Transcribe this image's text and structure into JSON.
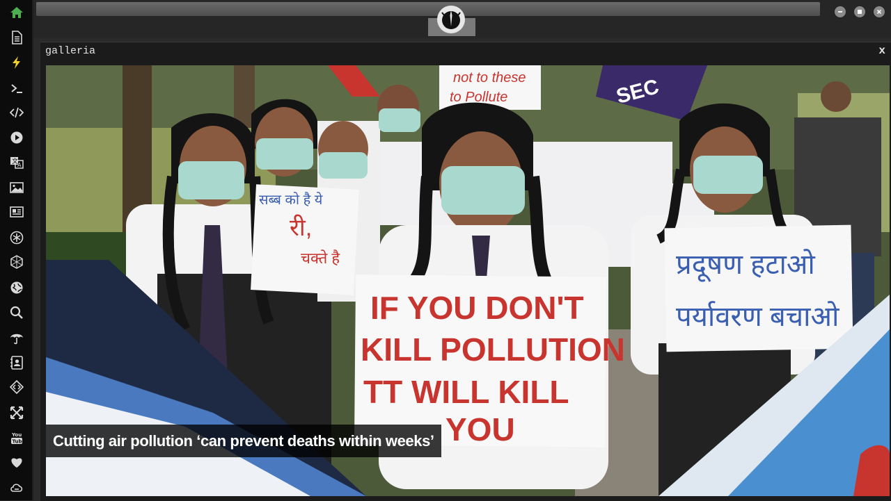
{
  "window": {
    "panel_title": "galleria",
    "close_label": "x"
  },
  "sidebar": {
    "items": [
      {
        "icon": "home-icon",
        "color": "#4caf50"
      },
      {
        "icon": "document-icon"
      },
      {
        "icon": "lightning-icon",
        "color": "#f2d22e"
      },
      {
        "icon": "terminal-icon"
      },
      {
        "icon": "code-icon"
      },
      {
        "icon": "play-icon"
      },
      {
        "icon": "translate-icon"
      },
      {
        "icon": "image-icon"
      },
      {
        "icon": "newspaper-icon"
      },
      {
        "icon": "asterisk-icon"
      },
      {
        "icon": "hexagon-icon"
      },
      {
        "icon": "globe-icon"
      },
      {
        "icon": "search-icon"
      },
      {
        "icon": "umbrella-icon"
      },
      {
        "icon": "contact-icon"
      },
      {
        "icon": "diamond-code-icon"
      },
      {
        "icon": "expand-icon"
      },
      {
        "icon": "youtube-icon"
      },
      {
        "icon": "heart-icon"
      },
      {
        "icon": "cloud-link-icon"
      }
    ]
  },
  "gallery": {
    "caption": "Cutting air pollution ‘can prevent deaths within weeks’",
    "signs": {
      "main": [
        "IF  YOU DON'T",
        "KILL POLLUTION",
        "TT  WILL KILL",
        "YOU"
      ],
      "right": [
        "प्रदूषण हटाओ",
        "पर्यावरण बचाओ"
      ],
      "top": [
        "not to these",
        "to Pollute"
      ],
      "left": [
        "सब्ब को है ये",
        "री,",
        "चक्ते है"
      ]
    }
  }
}
